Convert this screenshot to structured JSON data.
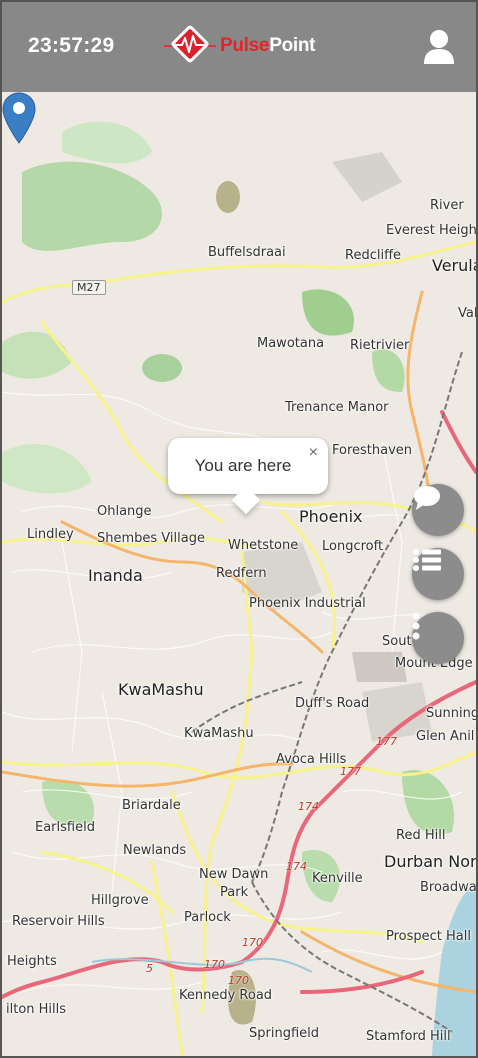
{
  "status_bar": {
    "time": "23:57:29"
  },
  "header": {
    "brand_part1": "Pulse",
    "brand_part2": "Point",
    "brand_color": "#e3242b",
    "header_color": "#888888",
    "logo_icon": "pulsepoint-logo-icon",
    "account_icon": "user-icon"
  },
  "map": {
    "popup_text": "You are here",
    "popup_close": "×",
    "marker_color": "#3a7ec6",
    "places": {
      "river": "River",
      "everest_heights": "Everest Height",
      "buffelsdraai": "Buffelsdraai",
      "redcliffe": "Redcliffe",
      "verulam": "Verula",
      "m27": "M27",
      "val": "Val",
      "mawotana": "Mawotana",
      "rietrivier": "Rietrivier",
      "trenance_manor": "Trenance Manor",
      "foresthaven": "Foresthaven",
      "ohlange": "Ohlange",
      "phoenix": "Phoenix",
      "lindley": "Lindley",
      "shembes_village": "Shembes Village",
      "whetstone": "Whetstone",
      "longcroft": "Longcroft",
      "inanda": "Inanda",
      "redfern": "Redfern",
      "phoenix_industrial": "Phoenix Industrial",
      "south": "Sout",
      "mount_edge": "Mount Edge",
      "kwamashu_big": "KwaMashu",
      "duffs_road": "Duff's Road",
      "sunning": "Sunning",
      "kwamashu_small": "KwaMashu",
      "glen_anil": "Glen Anil",
      "avoca_hills": "Avoca Hills",
      "r177a": "177",
      "r177b": "177",
      "briardale": "Briardale",
      "earlsfield": "Earlsfield",
      "r174a": "174",
      "red_hill": "Red Hill",
      "newlands": "Newlands",
      "durban_north": "Durban Nor",
      "new_dawn_park_1": "New Dawn",
      "new_dawn_park_2": "Park",
      "r174b": "174",
      "kenville": "Kenville",
      "broadway": "Broadwa",
      "hillgrove": "Hillgrove",
      "reservoir_hills": "Reservoir Hills",
      "parlock": "Parlock",
      "prospect_hall": "Prospect Hall",
      "r170a": "170",
      "heights": "Heights",
      "r5": "5",
      "r170b": "170",
      "r170c": "170",
      "kennedy_road": "Kennedy Road",
      "hilton_hills": "ilton Hills",
      "springfield": "Springfield",
      "stamford_hill": "Stamford Hill"
    }
  },
  "fabs": [
    {
      "icon": "chat-bubble-icon"
    },
    {
      "icon": "list-icon"
    },
    {
      "icon": "more-vertical-icon"
    }
  ]
}
